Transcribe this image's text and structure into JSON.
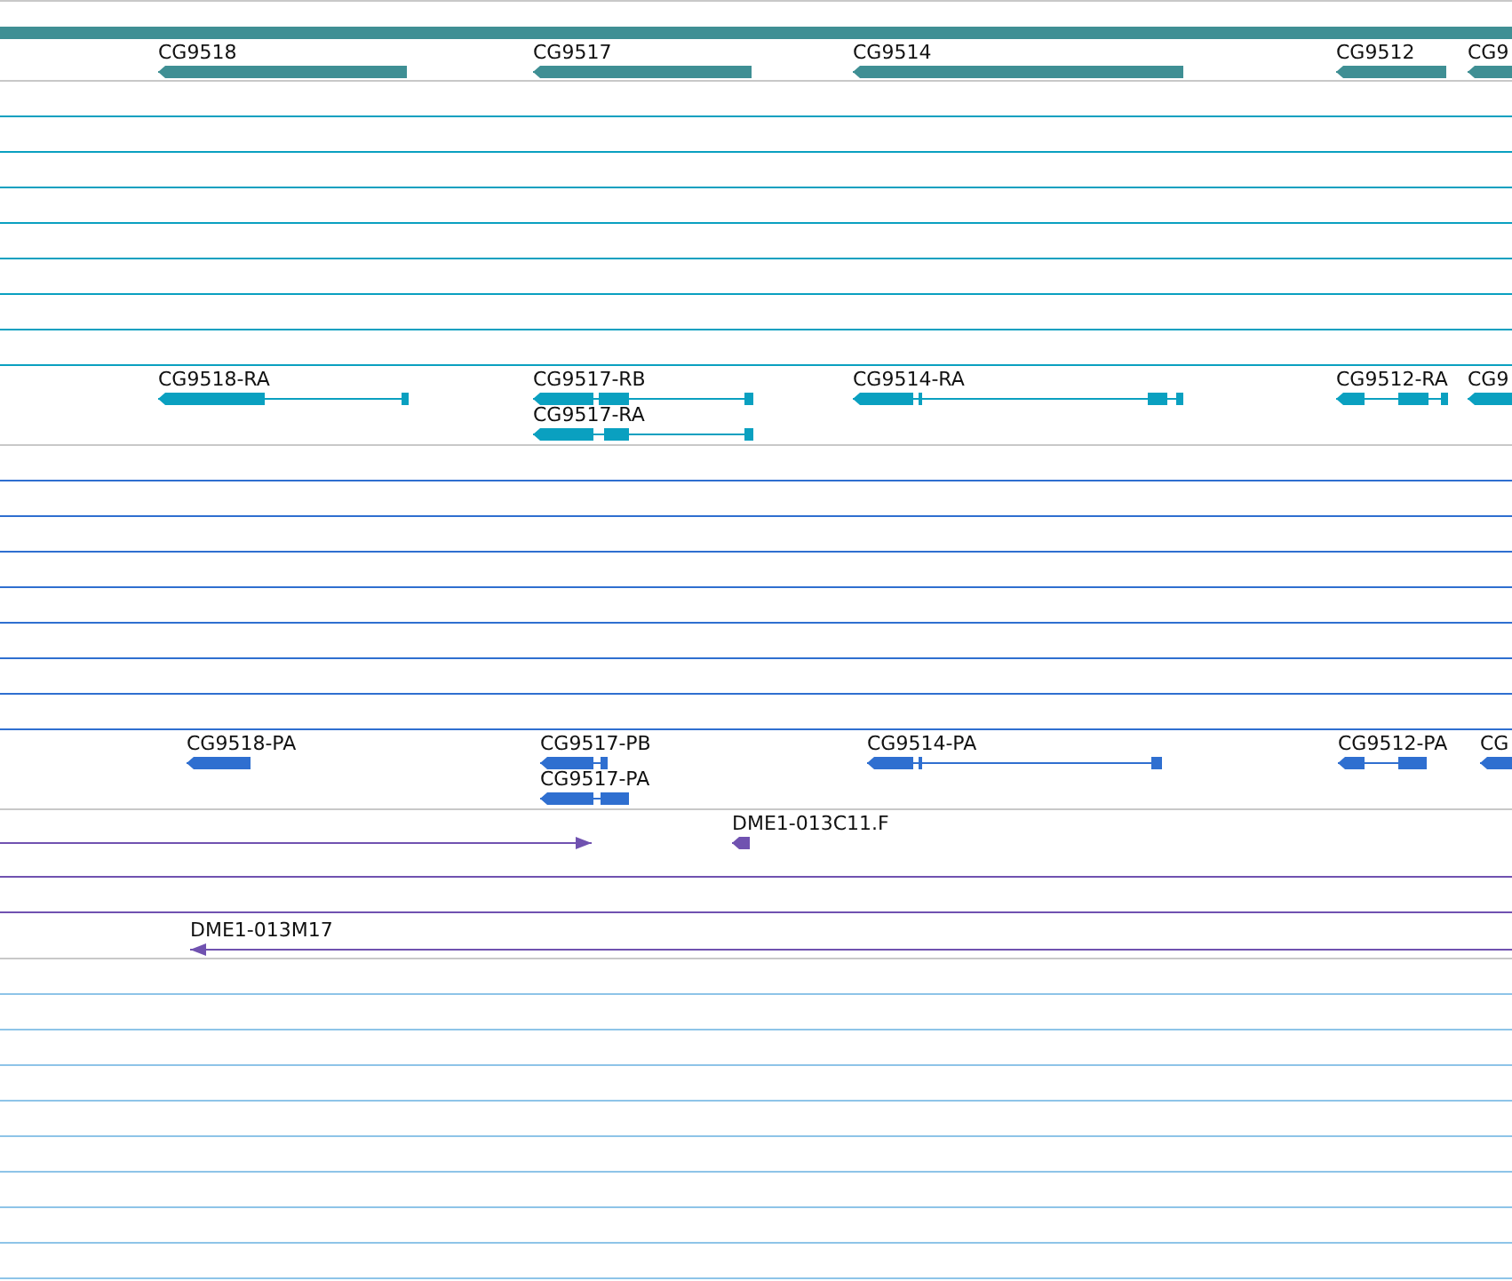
{
  "tracks": [
    {
      "kind": "genes",
      "features": [
        {
          "label": "CG9518",
          "reverse": true
        },
        {
          "label": "CG9517",
          "reverse": true
        },
        {
          "label": "CG9514",
          "reverse": true
        },
        {
          "label": "CG9512",
          "reverse": true
        },
        {
          "label": "CG9",
          "reverse": true
        }
      ]
    },
    {
      "kind": "transcripts",
      "features": [
        {
          "label": "CG9518-RA",
          "reverse": true
        },
        {
          "label": "CG9517-RB",
          "reverse": true
        },
        {
          "label": "CG9517-RA",
          "reverse": true
        },
        {
          "label": "CG9514-RA",
          "reverse": true
        },
        {
          "label": "CG9512-RA",
          "reverse": true
        },
        {
          "label": "CG9",
          "reverse": true
        }
      ]
    },
    {
      "kind": "proteins",
      "features": [
        {
          "label": "CG9518-PA",
          "reverse": true
        },
        {
          "label": "CG9517-PB",
          "reverse": true
        },
        {
          "label": "CG9517-PA",
          "reverse": true
        },
        {
          "label": "CG9514-PA",
          "reverse": true
        },
        {
          "label": "CG9512-PA",
          "reverse": true
        },
        {
          "label": "CG",
          "reverse": true
        }
      ]
    },
    {
      "kind": "clones",
      "features": [
        {
          "reverse": false
        },
        {
          "label": "DME1-013C11.F",
          "reverse": true
        },
        {
          "label": "DME1-013M17",
          "reverse": true
        }
      ]
    }
  ]
}
